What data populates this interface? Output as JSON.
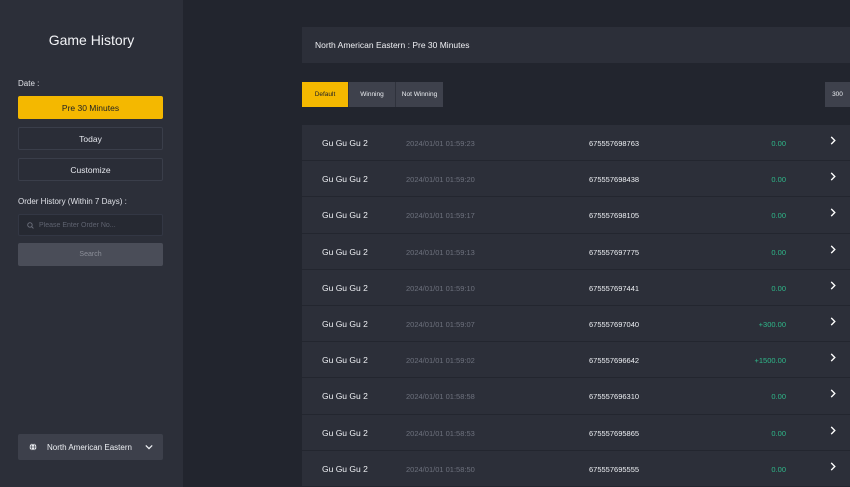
{
  "sidebar": {
    "title": "Game History",
    "date_label": "Date :",
    "date_buttons": [
      "Pre 30 Minutes",
      "Today",
      "Customize"
    ],
    "order_label": "Order History (Within 7 Days) :",
    "order_placeholder": "Please Enter Order No...",
    "search_label": "Search",
    "region": "North American Eastern"
  },
  "header": {
    "text": "North American Eastern : Pre 30 Minutes"
  },
  "filters": [
    "Default",
    "Winning",
    "Not Winning"
  ],
  "count": "300",
  "colors": {
    "accent": "#f4b800",
    "win": "#2fb88a",
    "panel": "#2c2f39",
    "background": "#22252e"
  },
  "rows": [
    {
      "game": "Gu Gu Gu 2",
      "time": "2024/01/01 01:59:23",
      "order": "675557698763",
      "amount": "0.00"
    },
    {
      "game": "Gu Gu Gu 2",
      "time": "2024/01/01 01:59:20",
      "order": "675557698438",
      "amount": "0.00"
    },
    {
      "game": "Gu Gu Gu 2",
      "time": "2024/01/01 01:59:17",
      "order": "675557698105",
      "amount": "0.00"
    },
    {
      "game": "Gu Gu Gu 2",
      "time": "2024/01/01 01:59:13",
      "order": "675557697775",
      "amount": "0.00"
    },
    {
      "game": "Gu Gu Gu 2",
      "time": "2024/01/01 01:59:10",
      "order": "675557697441",
      "amount": "0.00"
    },
    {
      "game": "Gu Gu Gu 2",
      "time": "2024/01/01 01:59:07",
      "order": "675557697040",
      "amount": "+300.00"
    },
    {
      "game": "Gu Gu Gu 2",
      "time": "2024/01/01 01:59:02",
      "order": "675557696642",
      "amount": "+1500.00"
    },
    {
      "game": "Gu Gu Gu 2",
      "time": "2024/01/01 01:58:58",
      "order": "675557696310",
      "amount": "0.00"
    },
    {
      "game": "Gu Gu Gu 2",
      "time": "2024/01/01 01:58:53",
      "order": "675557695865",
      "amount": "0.00"
    },
    {
      "game": "Gu Gu Gu 2",
      "time": "2024/01/01 01:58:50",
      "order": "675557695555",
      "amount": "0.00"
    }
  ]
}
